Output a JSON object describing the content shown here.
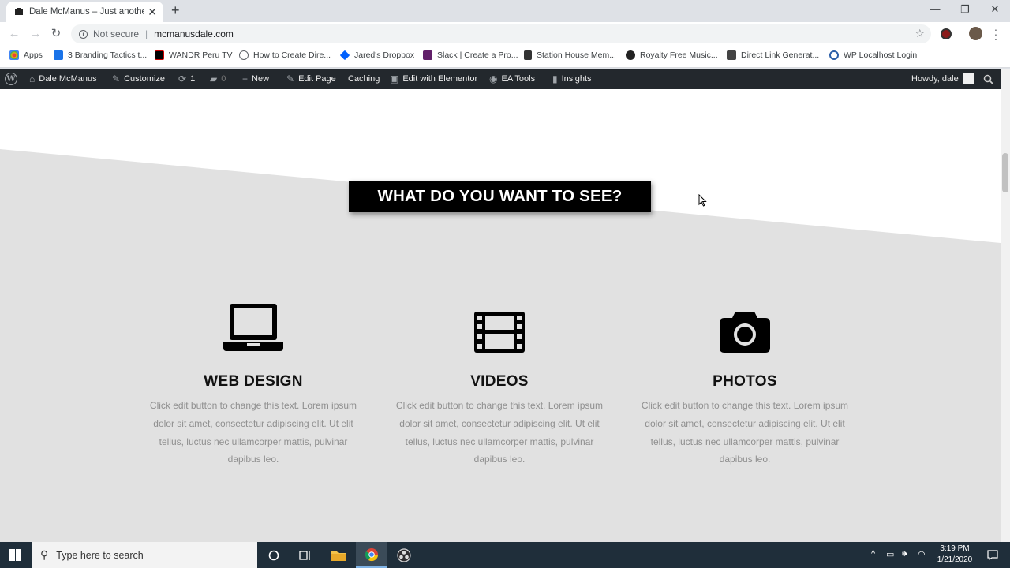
{
  "browser": {
    "tab_title": "Dale McManus – Just another W",
    "new_tab_symbol": "+",
    "close_symbol": "✕",
    "omnibox": {
      "security_label": "Not secure",
      "separator": "|",
      "url": "mcmanusdale.com"
    },
    "bookmarks": [
      {
        "label": "Apps",
        "icon": "apps-grid-icon",
        "color": "#ea4335"
      },
      {
        "label": "3 Branding Tactics t...",
        "icon": "d-logo-icon",
        "color": "#1a73e8"
      },
      {
        "label": "WANDR Peru TV",
        "icon": "wandr-icon",
        "color": "#000000"
      },
      {
        "label": "How to Create Dire...",
        "icon": "globe-icon",
        "color": "#5f6368"
      },
      {
        "label": "Jared's Dropbox",
        "icon": "dropbox-icon",
        "color": "#0061fe"
      },
      {
        "label": "Slack | Create a Pro...",
        "icon": "slack-icon",
        "color": "#611f69"
      },
      {
        "label": "Station House Mem...",
        "icon": "station-icon",
        "color": "#333333"
      },
      {
        "label": "Royalty Free Music...",
        "icon": "music-icon",
        "color": "#222222"
      },
      {
        "label": "Direct Link Generat...",
        "icon": "link-gen-icon",
        "color": "#444444"
      },
      {
        "label": "WP Localhost Login",
        "icon": "wp-login-icon",
        "color": "#2c5fa8"
      }
    ]
  },
  "wp_admin_bar": {
    "site_name": "Dale McManus",
    "customize": "Customize",
    "updates_count": "1",
    "comments_count": "0",
    "new": "New",
    "edit_page": "Edit Page",
    "caching": "Caching",
    "edit_elementor": "Edit with Elementor",
    "ea_tools": "EA Tools",
    "insights": "Insights",
    "greeting": "Howdy, dale"
  },
  "page": {
    "heading": "WHAT DO YOU WANT TO SEE?",
    "features": [
      {
        "title": "WEB DESIGN",
        "icon": "laptop-icon",
        "description": "Click edit button to change this text. Lorem ipsum dolor sit amet, consectetur adipiscing elit. Ut elit tellus, luctus nec ullamcorper mattis, pulvinar dapibus leo."
      },
      {
        "title": "VIDEOS",
        "icon": "film-icon",
        "description": "Click edit button to change this text. Lorem ipsum dolor sit amet, consectetur adipiscing elit. Ut elit tellus, luctus nec ullamcorper mattis, pulvinar dapibus leo."
      },
      {
        "title": "PHOTOS",
        "icon": "camera-icon",
        "description": "Click edit button to change this text. Lorem ipsum dolor sit amet, consectetur adipiscing elit. Ut elit tellus, luctus nec ullamcorper mattis, pulvinar dapibus leo."
      }
    ],
    "colors": {
      "section_bg": "#e1e1e1",
      "heading_bg": "#000000"
    }
  },
  "taskbar": {
    "search_placeholder": "Type here to search",
    "time": "3:19 PM",
    "date": "1/21/2020"
  }
}
